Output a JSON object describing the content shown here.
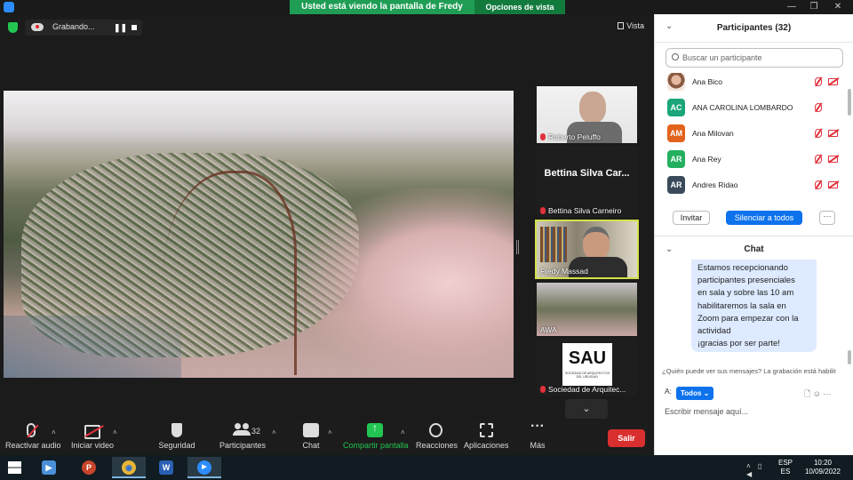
{
  "titlebar": {
    "share_banner": "Usted está viendo la pantalla de Fredy Massad",
    "view_options": "Opciones de vista",
    "minimize": "—",
    "maximize": "❐",
    "close": "✕"
  },
  "recording": {
    "status": "Grabando...",
    "pause_symbol": "❚❚"
  },
  "view": {
    "label": "Vista"
  },
  "thumbnails": {
    "roberto": "Roberto Peluffo",
    "bettina_big": "Bettina Silva Car...",
    "bettina": "Bettina Silva Carneiro",
    "fredy": "Fredy Massad",
    "awa": "AWA",
    "sau": "Sociedad de Arquitec...",
    "sau_logo": "SAU",
    "sau_sub": "SOCIEDAD DE ARQUITECTOS DEL URUGUAY",
    "scroll_down": "⌄"
  },
  "toolbar": {
    "audio": "Reactivar audio",
    "video": "Iniciar video",
    "security": "Seguridad",
    "participants": "Participantes",
    "participants_count": "32",
    "chat": "Chat",
    "share": "Compartir pantalla",
    "reactions": "Reacciones",
    "apps": "Aplicaciones",
    "more": "Más",
    "more_glyph": "···",
    "leave": "Salir",
    "caret": "˄"
  },
  "participants_panel": {
    "title": "Participantes (32)",
    "collapse": "⌄",
    "search_placeholder": "Buscar un participante",
    "list": [
      {
        "initials": "",
        "name": "Ana Bico",
        "color": "",
        "cam_off": true
      },
      {
        "initials": "AC",
        "name": "ANA CAROLINA LOMBARDO",
        "color": "#1aa67a",
        "cam_off": false
      },
      {
        "initials": "AM",
        "name": "Ana Milovan",
        "color": "#e2631d",
        "cam_off": true
      },
      {
        "initials": "AR",
        "name": "Ana Rey",
        "color": "#23b05f",
        "cam_off": true
      },
      {
        "initials": "AR",
        "name": "Andres Ridao",
        "color": "#3b4a5a",
        "cam_off": true
      }
    ],
    "invite": "Invitar",
    "mute_all": "Silenciar a todos",
    "more": "···"
  },
  "chat_panel": {
    "title": "Chat",
    "collapse": "⌄",
    "message_lines": [
      "Estamos recepcionando",
      "participantes presenciales",
      "en sala y sobre las 10 am",
      "habilitaremos la sala en",
      "Zoom para empezar con la",
      "actividad",
      "¡gracias por ser parte!"
    ],
    "who_can_see": "¿Quién puede ver sus mensajes? La grabación está habilit",
    "to_label": "A:",
    "to_value": "Todos ⌄",
    "icons": "🗋  ☺  ···",
    "input_placeholder": "Escribir mensaje aquí..."
  },
  "taskbar": {
    "apps": [
      {
        "name": "video-player",
        "glyph": "▶",
        "color": "#4a8fd8",
        "active": false
      },
      {
        "name": "powerpoint",
        "glyph": "P",
        "color": "#c8442a",
        "active": false
      },
      {
        "name": "chrome",
        "glyph": "◉",
        "color": "#e8b634",
        "active": true
      },
      {
        "name": "word",
        "glyph": "W",
        "color": "#2b5fb3",
        "active": false
      },
      {
        "name": "zoom",
        "glyph": "▶",
        "color": "#2d8cff",
        "active": true
      }
    ],
    "tray_icons": "˄ ▯ ◀",
    "lang_top": "ESP",
    "lang_bottom": "ES",
    "time": "10:20",
    "date": "10/09/2022"
  },
  "colors": {
    "share_green": "#1f9d55",
    "leave_red": "#d92f2f",
    "primary_blue": "#0e72ed",
    "active_speaker": "#d4e04a"
  }
}
